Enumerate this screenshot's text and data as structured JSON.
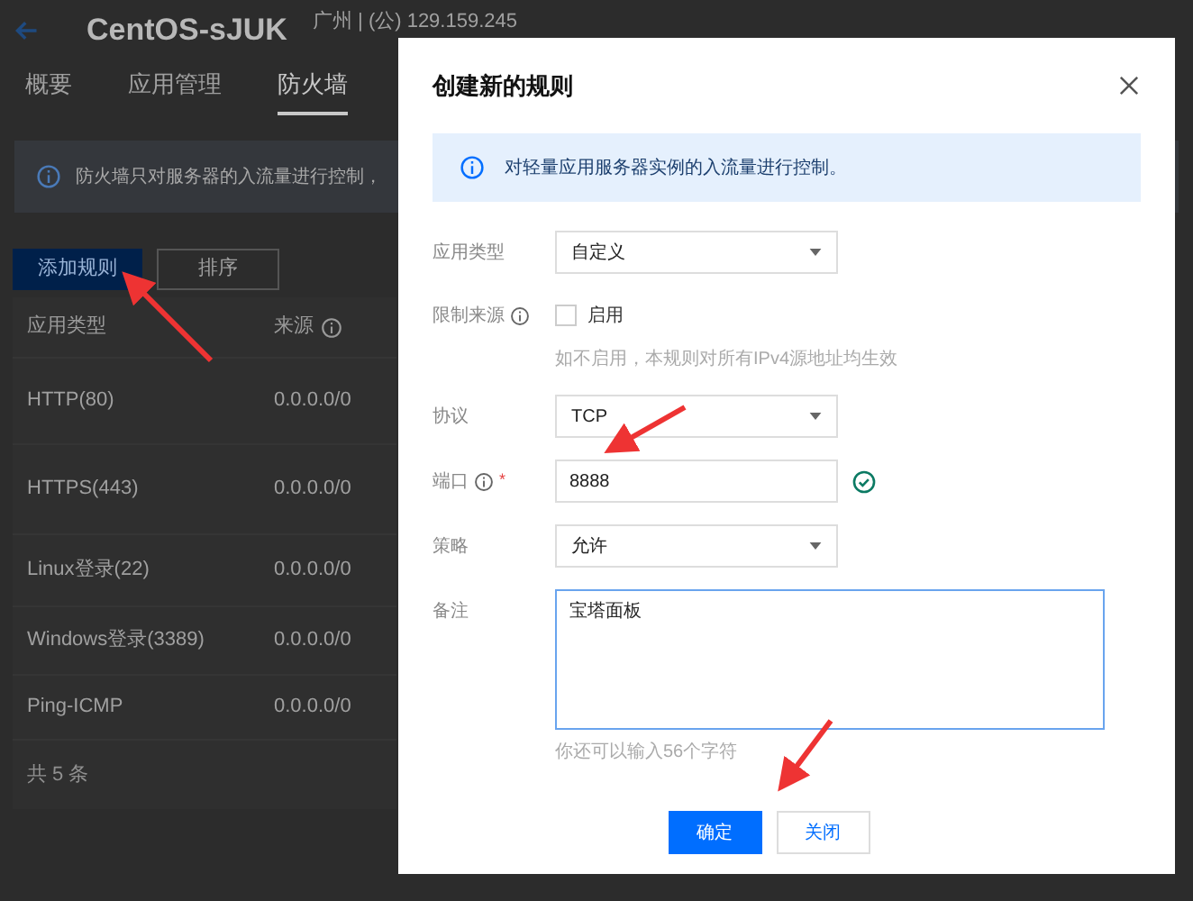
{
  "page": {
    "title": "CentOS-sJUK",
    "subtitle": "广州 | (公) 129.159.245",
    "tabs": [
      {
        "label": "概要",
        "selected": false
      },
      {
        "label": "应用管理",
        "selected": false
      },
      {
        "label": "防火墙",
        "selected": true
      }
    ],
    "notice": "防火墙只对服务器的入流量进行控制，",
    "buttons": [
      {
        "label": "添加规则",
        "kind": "primary"
      },
      {
        "label": "排序",
        "kind": "default"
      }
    ],
    "table": {
      "columns": [
        {
          "label": "应用类型",
          "info": false
        },
        {
          "label": "来源",
          "info": true
        }
      ],
      "rows": [
        [
          "HTTP(80)",
          "0.0.0.0/0"
        ],
        [
          "HTTPS(443)",
          "0.0.0.0/0"
        ],
        [
          "Linux登录(22)",
          "0.0.0.0/0"
        ],
        [
          "Windows登录(3389)",
          "0.0.0.0/0"
        ],
        [
          "Ping-ICMP",
          "0.0.0.0/0"
        ]
      ],
      "footer": "共 5 条"
    }
  },
  "dialog": {
    "title": "创建新的规则",
    "notice": "对轻量应用服务器实例的入流量进行控制。",
    "fields": [
      {
        "kind": "select",
        "label": "应用类型",
        "value": "自定义"
      },
      {
        "kind": "checkbox",
        "label": "限制来源",
        "info": true,
        "option": "启用",
        "checked": false,
        "hint": "如不启用，本规则对所有IPv4源地址均生效"
      },
      {
        "kind": "select",
        "label": "协议",
        "value": "TCP"
      },
      {
        "kind": "input",
        "label": "端口",
        "info": true,
        "required_mark": "*",
        "value": "8888",
        "valid": true
      },
      {
        "kind": "select",
        "label": "策略",
        "value": "允许"
      },
      {
        "kind": "textarea",
        "label": "备注",
        "value": "宝塔面板",
        "hint": "你还可以输入56个字符"
      }
    ],
    "buttons": [
      {
        "label": "确定",
        "kind": "primary"
      },
      {
        "label": "关闭",
        "kind": "default"
      }
    ]
  }
}
